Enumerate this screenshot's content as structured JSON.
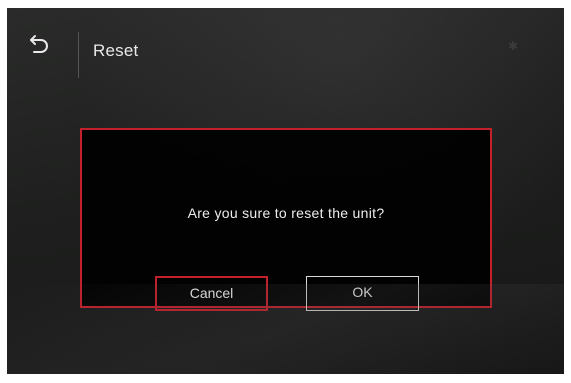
{
  "header": {
    "title": "Reset",
    "back_icon": "back-arrow-icon",
    "status_icon": "bluetooth-icon",
    "status_glyph": "✱"
  },
  "dialog": {
    "message": "Are you sure to reset the unit?",
    "cancel_label": "Cancel",
    "ok_label": "OK",
    "focused_button": "Cancel"
  },
  "colors": {
    "focus_border": "#c4202c",
    "text": "#ededed",
    "background": "#1e1f1e"
  }
}
